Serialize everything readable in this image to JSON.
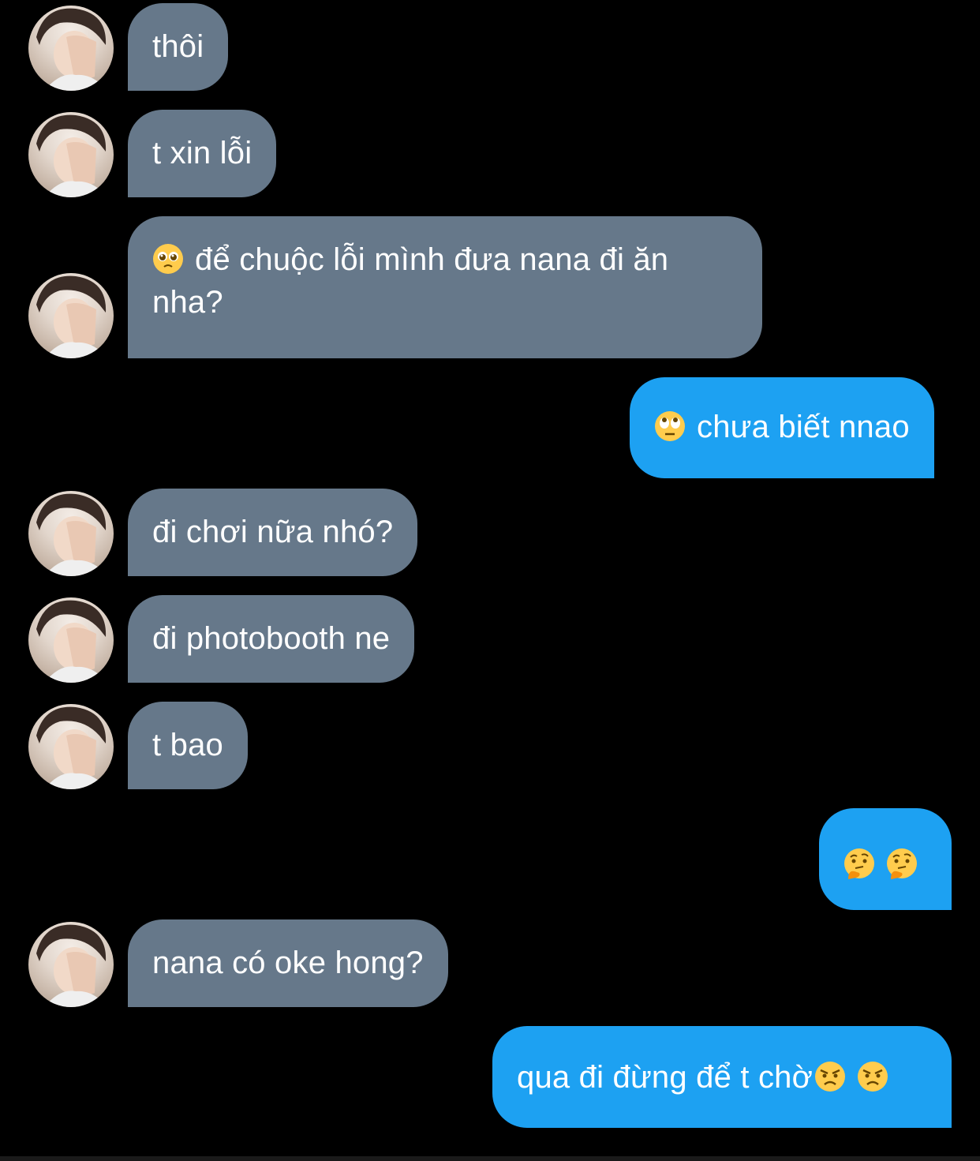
{
  "messages": [
    {
      "side": "in",
      "text": "thôi",
      "emoji": null
    },
    {
      "side": "in",
      "text": "t xin lỗi",
      "emoji": null
    },
    {
      "side": "in",
      "text": "để chuộc lỗi mình đưa nana đi ăn nha?",
      "emoji": "pleading-face-icon"
    },
    {
      "side": "out",
      "text": "chưa biết nnao",
      "emoji": "eye-roll-face-icon"
    },
    {
      "side": "in",
      "text": "đi chơi nữa nhó?",
      "emoji": null
    },
    {
      "side": "in",
      "text": "đi photobooth ne",
      "emoji": null
    },
    {
      "side": "in",
      "text": "t bao",
      "emoji": null
    },
    {
      "side": "out",
      "text": "",
      "emoji": [
        "thinking-face-icon",
        "thinking-face-icon"
      ]
    },
    {
      "side": "in",
      "text": "nana có oke hong?",
      "emoji": null
    },
    {
      "side": "out",
      "text": "qua đi đừng để t chờ",
      "emoji": [
        "angry-face-icon",
        "angry-face-icon"
      ]
    }
  ],
  "colors": {
    "background": "#000000",
    "incoming_bubble": "#66788a",
    "outgoing_bubble": "#1da1f2",
    "text": "#ffffff"
  }
}
